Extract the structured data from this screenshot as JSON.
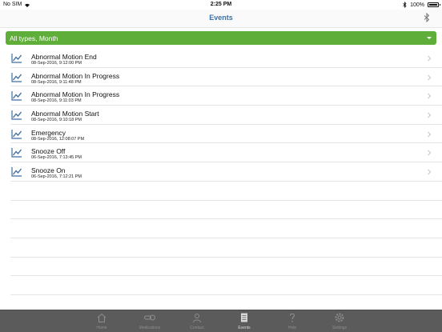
{
  "status_bar": {
    "carrier": "No SIM",
    "time": "2:25 PM",
    "battery": "100%"
  },
  "nav": {
    "title": "Events"
  },
  "filter": {
    "label": "All types, Month"
  },
  "events": [
    {
      "name": "Abnormal Motion End",
      "date": "08-Sep-2016, 9:12:00 PM"
    },
    {
      "name": "Abnormal Motion In Progress",
      "date": "08-Sep-2016, 9:11:48 PM"
    },
    {
      "name": "Abnormal Motion In Progress",
      "date": "08-Sep-2016, 9:11:03 PM"
    },
    {
      "name": "Abnormal Motion Start",
      "date": "08-Sep-2016, 9:10:18 PM"
    },
    {
      "name": "Emergency",
      "date": "08-Sep-2016, 12:08:07 PM"
    },
    {
      "name": "Snooze Off",
      "date": "06-Sep-2016, 7:13:45 PM"
    },
    {
      "name": "Snooze On",
      "date": "06-Sep-2016, 7:12:21 PM"
    }
  ],
  "tabs": [
    {
      "label": "Home",
      "icon": "house-icon"
    },
    {
      "label": "Medications",
      "icon": "pills-icon"
    },
    {
      "label": "Contact",
      "icon": "person-icon"
    },
    {
      "label": "Events",
      "icon": "document-icon"
    },
    {
      "label": "Help",
      "icon": "question-icon"
    },
    {
      "label": "Settings",
      "icon": "gear-icon"
    }
  ],
  "colors": {
    "accent_green": "#5fae3a",
    "title_blue": "#3d6fa3",
    "tabbar_bg": "#5b5b5b"
  }
}
